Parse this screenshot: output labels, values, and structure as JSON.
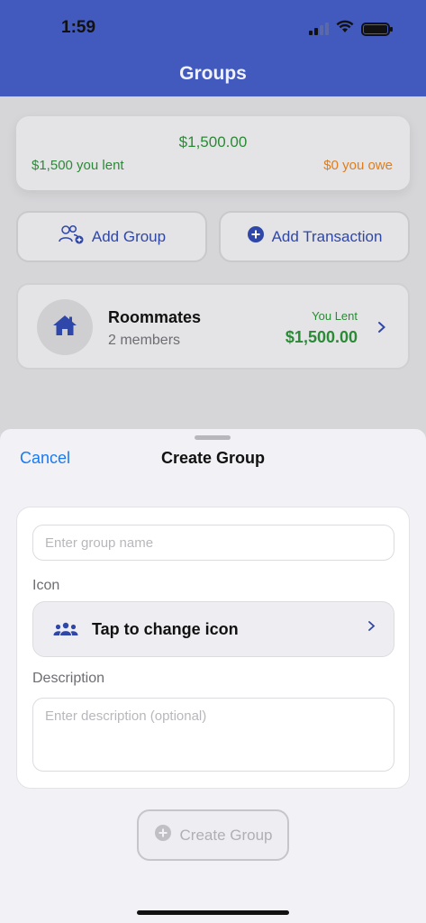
{
  "status_bar": {
    "time": "1:59"
  },
  "nav": {
    "title": "Groups"
  },
  "summary": {
    "total": "$1,500.00",
    "lent": "$1,500 you lent",
    "owe": "$0 you owe",
    "colors": {
      "positive": "#2a8a36",
      "owe": "#e07d1a"
    }
  },
  "actions": {
    "add_group": {
      "label": "Add Group",
      "icon": "add-people-icon"
    },
    "add_transaction": {
      "label": "Add Transaction",
      "icon": "plus-circle-icon"
    }
  },
  "groups": [
    {
      "name": "Roommates",
      "members": "2 members",
      "status_label": "You Lent",
      "amount": "$1,500.00",
      "icon": "house-icon"
    }
  ],
  "sheet": {
    "title": "Create Group",
    "cancel_label": "Cancel",
    "name_field": {
      "placeholder": "Enter group name",
      "value": ""
    },
    "icon_label": "Icon",
    "icon_picker": {
      "label": "Tap to change icon",
      "icon": "people-icon"
    },
    "description_label": "Description",
    "description_field": {
      "placeholder": "Enter description (optional)",
      "value": ""
    },
    "create_button": {
      "label": "Create Group",
      "enabled": false
    }
  },
  "theme": {
    "accent": "#4259bd",
    "link": "#1a7af0"
  }
}
